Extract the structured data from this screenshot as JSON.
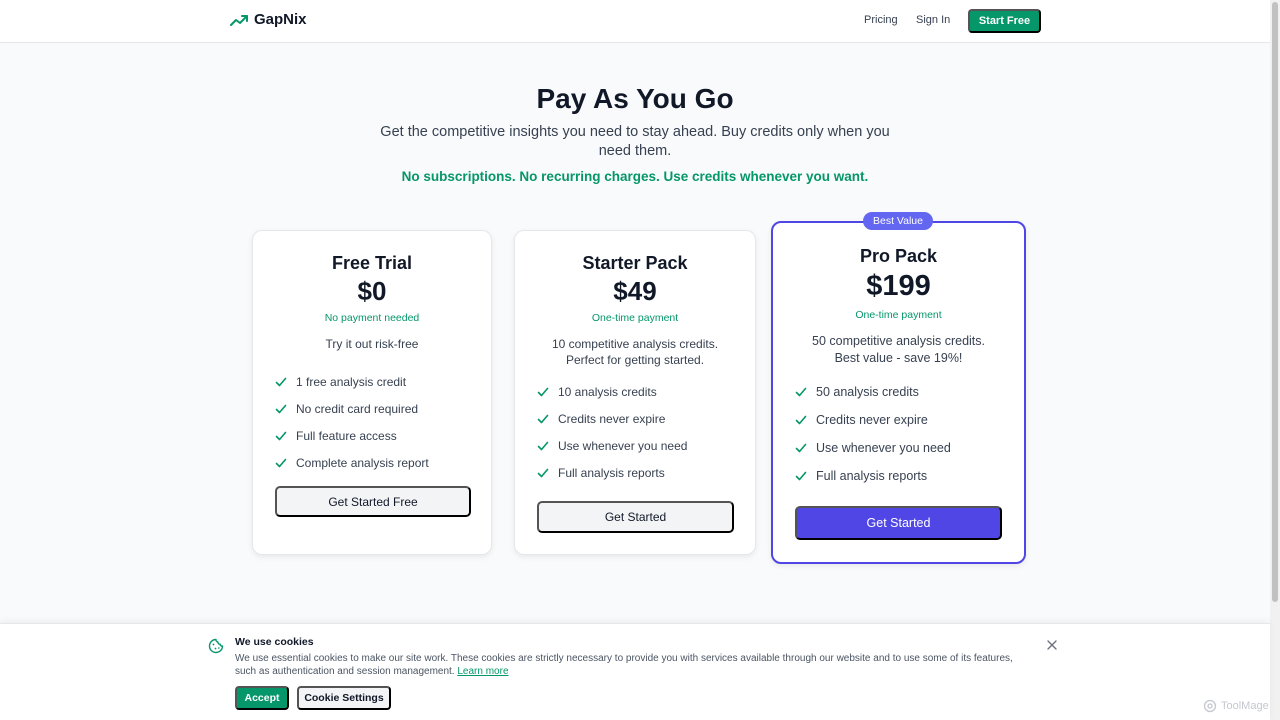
{
  "nav": {
    "brand": "GapNix",
    "pricing": "Pricing",
    "sign_in": "Sign In",
    "start_free": "Start Free"
  },
  "hero": {
    "title": "Pay As You Go",
    "subtitle": "Get the competitive insights you need to stay ahead. Buy credits only when you need them.",
    "note": "No subscriptions. No recurring charges. Use credits whenever you want."
  },
  "plans": [
    {
      "title": "Free Trial",
      "price": "$0",
      "payment": "No payment needed",
      "description": "Try it out risk-free",
      "features": [
        "1 free analysis credit",
        "No credit card required",
        "Full feature access",
        "Complete analysis report"
      ],
      "button": "Get Started Free"
    },
    {
      "title": "Starter Pack",
      "price": "$49",
      "payment": "One-time payment",
      "description": "10 competitive analysis credits. Perfect for getting started.",
      "features": [
        "10 analysis credits",
        "Credits never expire",
        "Use whenever you need",
        "Full analysis reports"
      ],
      "button": "Get Started"
    },
    {
      "badge": "Best Value",
      "title": "Pro Pack",
      "price": "$199",
      "payment": "One-time payment",
      "description": "50 competitive analysis credits. Best value - save 19%!",
      "features": [
        "50 analysis credits",
        "Credits never expire",
        "Use whenever you need",
        "Full analysis reports"
      ],
      "button": "Get Started"
    }
  ],
  "cookie": {
    "title": "We use cookies",
    "text": "We use essential cookies to make our site work. These cookies are strictly necessary to provide you with services available through our website and to use some of its features, such as authentication and session management.",
    "learn_more": "Learn more",
    "accept": "Accept",
    "settings": "Cookie Settings"
  },
  "watermark": "ToolMage",
  "colors": {
    "brand_green": "#059669",
    "accent_indigo": "#4f46e5",
    "badge_indigo": "#6366f1"
  }
}
